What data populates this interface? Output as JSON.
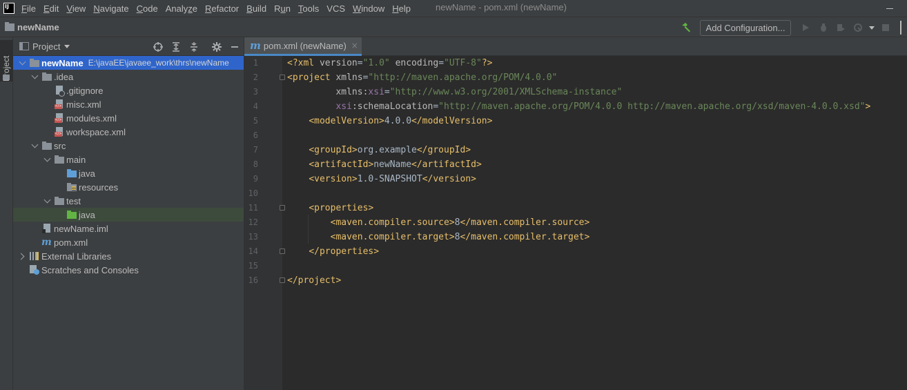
{
  "menubar": {
    "logo": "IJ",
    "items": [
      {
        "label": "File",
        "u": "F",
        "rest": "ile"
      },
      {
        "label": "Edit",
        "u": "E",
        "rest": "dit"
      },
      {
        "label": "View",
        "u": "V",
        "rest": "iew"
      },
      {
        "label": "Navigate",
        "u": "N",
        "rest": "avigate"
      },
      {
        "label": "Code",
        "u": "C",
        "rest": "ode"
      },
      {
        "label": "Analyze",
        "pre": "Analy",
        "u": "z",
        "rest": "e"
      },
      {
        "label": "Refactor",
        "u": "R",
        "rest": "efactor"
      },
      {
        "label": "Build",
        "u": "B",
        "rest": "uild"
      },
      {
        "label": "Run",
        "pre": "R",
        "u": "u",
        "rest": "n"
      },
      {
        "label": "Tools",
        "u": "T",
        "rest": "ools"
      },
      {
        "label": "VCS",
        "pre": "VC",
        "u": "",
        "rest": "S"
      },
      {
        "label": "Window",
        "u": "W",
        "rest": "indow"
      },
      {
        "label": "Help",
        "u": "H",
        "rest": "elp"
      }
    ],
    "window_title": "newName - pom.xml (newName)"
  },
  "navbar": {
    "project_name": "newName",
    "add_configuration": "Add Configuration...",
    "icons": [
      "build-hammer-icon",
      "run-icon",
      "debug-icon",
      "coverage-icon",
      "profile-icon",
      "stop-icon"
    ]
  },
  "left_strip": {
    "label": "Project"
  },
  "project_panel": {
    "title": "Project",
    "header_icons": [
      "locate-icon",
      "expand-all-icon",
      "collapse-all-icon",
      "settings-icon",
      "hide-icon"
    ],
    "tree": [
      {
        "label": "newName",
        "hint": "E:\\javaEE\\javaee_work\\thrs\\newName",
        "depth": 0,
        "arrow": "down",
        "icon": "folder",
        "selected": true,
        "bold": true
      },
      {
        "label": ".idea",
        "depth": 1,
        "arrow": "down",
        "icon": "folder"
      },
      {
        "label": ".gitignore",
        "depth": 2,
        "arrow": "none",
        "icon": "git"
      },
      {
        "label": "misc.xml",
        "depth": 2,
        "arrow": "none",
        "icon": "xml"
      },
      {
        "label": "modules.xml",
        "depth": 2,
        "arrow": "none",
        "icon": "xml"
      },
      {
        "label": "workspace.xml",
        "depth": 2,
        "arrow": "none",
        "icon": "xml"
      },
      {
        "label": "src",
        "depth": 1,
        "arrow": "down",
        "icon": "folder"
      },
      {
        "label": "main",
        "depth": 2,
        "arrow": "down",
        "icon": "folder"
      },
      {
        "label": "java",
        "depth": 3,
        "arrow": "none",
        "icon": "folder-blue"
      },
      {
        "label": "resources",
        "depth": 3,
        "arrow": "none",
        "icon": "folder-res"
      },
      {
        "label": "test",
        "depth": 2,
        "arrow": "down",
        "icon": "folder"
      },
      {
        "label": "java",
        "depth": 3,
        "arrow": "none",
        "icon": "folder-green",
        "highlight": true
      },
      {
        "label": "newName.iml",
        "depth": 1,
        "arrow": "none",
        "icon": "iml"
      },
      {
        "label": "pom.xml",
        "depth": 1,
        "arrow": "none",
        "icon": "maven"
      },
      {
        "label": "External Libraries",
        "depth": 0,
        "arrow": "right",
        "icon": "lib"
      },
      {
        "label": "Scratches and Consoles",
        "depth": 0,
        "arrow": "none",
        "icon": "scratch"
      }
    ]
  },
  "editor": {
    "tab_label": "pom.xml (newName)",
    "tab_close": "×",
    "line_numbers": [
      "1",
      "2",
      "3",
      "4",
      "5",
      "6",
      "7",
      "8",
      "9",
      "10",
      "11",
      "12",
      "13",
      "14",
      "15",
      "16"
    ],
    "lines": [
      [
        {
          "t": "decl",
          "v": "<?xml "
        },
        {
          "t": "attr",
          "v": "version"
        },
        {
          "t": "txt",
          "v": "="
        },
        {
          "t": "str",
          "v": "\"1.0\""
        },
        {
          "t": "txt",
          "v": " "
        },
        {
          "t": "attr",
          "v": "encoding"
        },
        {
          "t": "txt",
          "v": "="
        },
        {
          "t": "str",
          "v": "\"UTF-8\""
        },
        {
          "t": "decl",
          "v": "?>"
        }
      ],
      [
        {
          "t": "tag",
          "v": "<project "
        },
        {
          "t": "attr",
          "v": "xmlns"
        },
        {
          "t": "txt",
          "v": "="
        },
        {
          "t": "str",
          "v": "\"http://maven.apache.org/POM/4.0.0\""
        }
      ],
      [
        {
          "t": "txt",
          "v": "         "
        },
        {
          "t": "attr",
          "v": "xmlns:"
        },
        {
          "t": "ns",
          "v": "xsi"
        },
        {
          "t": "txt",
          "v": "="
        },
        {
          "t": "str",
          "v": "\"http://www.w3.org/2001/XMLSchema-instance\""
        }
      ],
      [
        {
          "t": "txt",
          "v": "         "
        },
        {
          "t": "ns",
          "v": "xsi"
        },
        {
          "t": "attr",
          "v": ":schemaLocation"
        },
        {
          "t": "txt",
          "v": "="
        },
        {
          "t": "str",
          "v": "\"http://maven.apache.org/POM/4.0.0 http://maven.apache.org/xsd/maven-4.0.0.xsd\""
        },
        {
          "t": "tag",
          "v": ">"
        }
      ],
      [
        {
          "t": "txt",
          "v": "    "
        },
        {
          "t": "tag",
          "v": "<modelVersion>"
        },
        {
          "t": "txt",
          "v": "4.0.0"
        },
        {
          "t": "tag",
          "v": "</modelVersion>"
        }
      ],
      [],
      [
        {
          "t": "txt",
          "v": "    "
        },
        {
          "t": "tag",
          "v": "<groupId>"
        },
        {
          "t": "txt",
          "v": "org.example"
        },
        {
          "t": "tag",
          "v": "</groupId>"
        }
      ],
      [
        {
          "t": "txt",
          "v": "    "
        },
        {
          "t": "tag",
          "v": "<artifactId>"
        },
        {
          "t": "txt",
          "v": "newName"
        },
        {
          "t": "tag",
          "v": "</artifactId>"
        }
      ],
      [
        {
          "t": "txt",
          "v": "    "
        },
        {
          "t": "tag",
          "v": "<version>"
        },
        {
          "t": "txt",
          "v": "1.0-SNAPSHOT"
        },
        {
          "t": "tag",
          "v": "</version>"
        }
      ],
      [],
      [
        {
          "t": "txt",
          "v": "    "
        },
        {
          "t": "tag",
          "v": "<properties>"
        }
      ],
      [
        {
          "t": "txt",
          "v": "        "
        },
        {
          "t": "tag",
          "v": "<maven.compiler.source>"
        },
        {
          "t": "txt",
          "v": "8"
        },
        {
          "t": "tag",
          "v": "</maven.compiler.source>"
        }
      ],
      [
        {
          "t": "txt",
          "v": "        "
        },
        {
          "t": "tag",
          "v": "<maven.compiler.target>"
        },
        {
          "t": "txt",
          "v": "8"
        },
        {
          "t": "tag",
          "v": "</maven.compiler.target>"
        }
      ],
      [
        {
          "t": "txt",
          "v": "    "
        },
        {
          "t": "tag",
          "v": "</properties>"
        }
      ],
      [],
      [
        {
          "t": "tag",
          "v": "</project>"
        }
      ]
    ]
  }
}
